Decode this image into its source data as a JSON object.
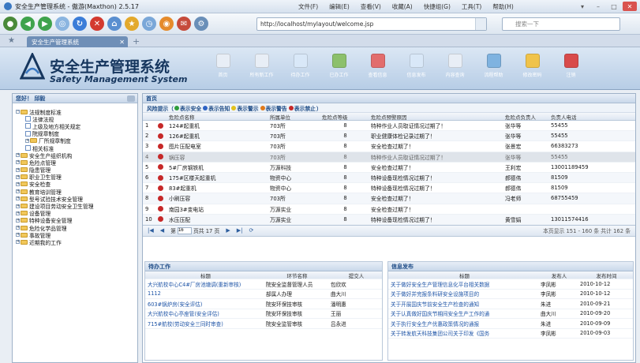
{
  "window": {
    "title": "安全生产管理系统 - 傲游(Maxthon) 2.5.17",
    "menu": [
      "文件(F)",
      "编辑(E)",
      "查看(V)",
      "收藏(A)",
      "快捷组(G)",
      "工具(T)",
      "帮助(H)"
    ],
    "controls": [
      "▾",
      "–",
      "□",
      "✕"
    ]
  },
  "browser": {
    "address": "http://localhost/mylayout/welcome.jsp",
    "search_placeholder": "搜索一下",
    "tab_label": "安全生产管理系统",
    "tab_close": "✕",
    "tab_add": "+",
    "tab_star": "★"
  },
  "app": {
    "title": "安全生产管理系统",
    "subtitle": "Safety Management System",
    "nav": [
      {
        "label": "首页",
        "color": "#e8eef6"
      },
      {
        "label": "所有新工作",
        "color": "#e8eef6"
      },
      {
        "label": "待办工作",
        "color": "#d9e8f8"
      },
      {
        "label": "已办工作",
        "color": "#8cc06b"
      },
      {
        "label": "查看信息",
        "color": "#e26d6d"
      },
      {
        "label": "信息发布",
        "color": "#d9e8f8"
      },
      {
        "label": "内容查询",
        "color": "#e8eef6"
      },
      {
        "label": "流程帮助",
        "color": "#7fb3e0"
      },
      {
        "label": "修改密码",
        "color": "#f0c34a"
      },
      {
        "label": "注销",
        "color": "#d84a4a"
      }
    ]
  },
  "sidebar": {
    "header": "您好！ 邱毅",
    "items": [
      {
        "label": "法规制度标准",
        "indent": 0,
        "kind": "folder-open"
      },
      {
        "label": "法律法规",
        "indent": 1,
        "kind": "doc"
      },
      {
        "label": "上级及地方相关规定",
        "indent": 1,
        "kind": "doc"
      },
      {
        "label": "院规章制度",
        "indent": 1,
        "kind": "doc"
      },
      {
        "label": "厂所规章制度",
        "indent": 1,
        "kind": "folder"
      },
      {
        "label": "相关标准",
        "indent": 1,
        "kind": "doc"
      },
      {
        "label": "安全生产组织机构",
        "indent": 0,
        "kind": "folder"
      },
      {
        "label": "危险点管理",
        "indent": 0,
        "kind": "folder"
      },
      {
        "label": "隐患管理",
        "indent": 0,
        "kind": "folder"
      },
      {
        "label": "职业卫生管理",
        "indent": 0,
        "kind": "folder"
      },
      {
        "label": "安全检查",
        "indent": 0,
        "kind": "folder"
      },
      {
        "label": "教育培训管理",
        "indent": 0,
        "kind": "folder"
      },
      {
        "label": "型号试验技术安全管理",
        "indent": 0,
        "kind": "folder"
      },
      {
        "label": "建设项目劳动安全卫生管理",
        "indent": 0,
        "kind": "folder"
      },
      {
        "label": "设备管理",
        "indent": 0,
        "kind": "folder"
      },
      {
        "label": "特种设备安全管理",
        "indent": 0,
        "kind": "folder"
      },
      {
        "label": "危险化学品管理",
        "indent": 0,
        "kind": "folder"
      },
      {
        "label": "事故管理",
        "indent": 0,
        "kind": "folder"
      },
      {
        "label": "近期我的工作",
        "indent": 0,
        "kind": "folder"
      }
    ]
  },
  "main": {
    "header": "首页",
    "risk_legend": {
      "prefix": "风险提示（",
      "items": [
        {
          "label": "表示安全",
          "color": "#2e9d3a"
        },
        {
          "label": "表示告知",
          "color": "#2e63c4"
        },
        {
          "label": "表示警示",
          "color": "#e2c21c"
        },
        {
          "label": "表示警告",
          "color": "#e07a1a"
        },
        {
          "label": "表示禁止",
          "color": "#c62828"
        }
      ],
      "suffix": "）"
    },
    "columns": [
      "",
      "",
      "危险点名称",
      "所属单位",
      "危险点等级",
      "危险点预警原因",
      "危险点负责人",
      "负责人电话"
    ],
    "rows": [
      {
        "no": "1",
        "name": "124#起重机",
        "unit": "703所",
        "level": "8",
        "reason": "特种作业人员取证情况过期了！",
        "owner": "张华等",
        "phone": "55455"
      },
      {
        "no": "2",
        "name": "126#起重机",
        "unit": "703所",
        "level": "8",
        "reason": "职业健康体检记录过期了！",
        "owner": "张华等",
        "phone": "55455"
      },
      {
        "no": "3",
        "name": "图片压配电室",
        "unit": "703所",
        "level": "8",
        "reason": "安全检查过期了！",
        "owner": "张景宏",
        "phone": "66383273"
      },
      {
        "no": "4",
        "name": "锅压容",
        "unit": "703所",
        "level": "8",
        "reason": "特种作业人员取证情况过期了！",
        "owner": "张华等",
        "phone": "55455"
      },
      {
        "no": "5",
        "name": "5#厂房钢铁机",
        "unit": "万源科技",
        "level": "8",
        "reason": "安全检查过期了！",
        "owner": "王利宏",
        "phone": "13001189459"
      },
      {
        "no": "6",
        "name": "175#区楼天起重机",
        "unit": "物资中心",
        "level": "8",
        "reason": "特种设备现检情况过期了！",
        "owner": "郝德伟",
        "phone": "81509"
      },
      {
        "no": "7",
        "name": "83#起重机",
        "unit": "物资中心",
        "level": "8",
        "reason": "特种设备现检情况过期了！",
        "owner": "郝德伟",
        "phone": "81509"
      },
      {
        "no": "8",
        "name": "小刷压容",
        "unit": "703所",
        "level": "8",
        "reason": "安全检查过期了！",
        "owner": "冯老师",
        "phone": "68755459"
      },
      {
        "no": "9",
        "name": "南园3#变电站",
        "unit": "万源实业",
        "level": "8",
        "reason": "安全检查过期了！",
        "owner": "",
        "phone": ""
      },
      {
        "no": "10",
        "name": "水压压配",
        "unit": "万源实业",
        "level": "8",
        "reason": "特种设备现检情况过期了！",
        "owner": "黄雪娟",
        "phone": "13011574416"
      }
    ],
    "pager": {
      "first": "|◀",
      "prev": "◀",
      "page_prefix": "第",
      "page_value": "16",
      "page_suffix": "页共 17 页",
      "next": "▶",
      "last": "▶|",
      "refresh": "⟳",
      "info": "本页显示 151 - 160 条 共计 162 条"
    },
    "todo": {
      "header": "待办工作",
      "columns": [
        "标题",
        "环节名称",
        "提交人"
      ],
      "rows": [
        {
          "title": "大兴航校中心C4#厂房池塘调(重新审核)",
          "step": "院安全监督管理人员",
          "by": "包欣欢"
        },
        {
          "title": "1112",
          "step": "部属人办理",
          "by": "曲大川"
        },
        {
          "title": "603#锅炉房(安全评估)",
          "step": "院安环保技审核",
          "by": "潘明惠"
        },
        {
          "title": "大兴航校中心亭座管(安全评估)",
          "step": "院安环保技审核",
          "by": "王丽"
        },
        {
          "title": "715#航校(劳动安全三同时审查)",
          "step": "院安全监管审核",
          "by": "吕永进"
        }
      ]
    },
    "news": {
      "header": "信息发布",
      "columns": [
        "标题",
        "发布人",
        "发布时间"
      ],
      "rows": [
        {
          "title": "关于做好安全生产管理信息化平台相关数据",
          "by": "李凤彬",
          "date": "2010-10-12"
        },
        {
          "title": "关于做好并完报条料研安全设施项目的",
          "by": "李凤彬",
          "date": "2010-10-12"
        },
        {
          "title": "关于开展国庆节前安全生产检查的通知",
          "by": "朱进",
          "date": "2010-09-21"
        },
        {
          "title": "关于认真做好国庆节期间安全生产工作的通",
          "by": "曲大川",
          "date": "2010-09-20"
        },
        {
          "title": "关于执行安全生产优惠政策情况的通报",
          "by": "朱进",
          "date": "2010-09-09"
        },
        {
          "title": "关于转发航天科技集团公司关于印发《国务",
          "by": "李凤彬",
          "date": "2010-09-03"
        }
      ]
    }
  }
}
